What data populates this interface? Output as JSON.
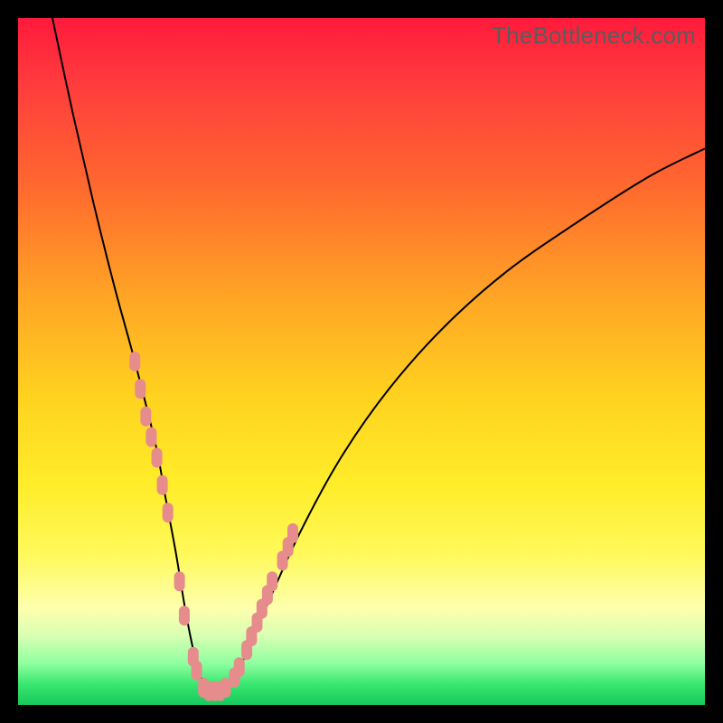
{
  "watermark": "TheBottleneck.com",
  "colors": {
    "frame": "#000000",
    "marker": "#e68c8c",
    "curve": "#000000"
  },
  "chart_data": {
    "type": "line",
    "title": "",
    "xlabel": "",
    "ylabel": "",
    "xlim": [
      0,
      100
    ],
    "ylim": [
      0,
      100
    ],
    "series": [
      {
        "name": "bottleneck-curve",
        "x": [
          5,
          8,
          11,
          14,
          17,
          20,
          21.5,
          23,
          24.5,
          26,
          27.5,
          29,
          32,
          36,
          41,
          47,
          54,
          62,
          71,
          81,
          92,
          100
        ],
        "y": [
          100,
          86,
          73,
          61,
          50,
          38,
          30,
          22,
          13,
          6,
          2,
          2,
          5,
          14,
          25,
          36,
          46,
          55,
          63,
          70,
          77,
          81
        ]
      }
    ],
    "markers": {
      "name": "highlighted-segments",
      "points": [
        {
          "x": 17.0,
          "y": 50
        },
        {
          "x": 17.8,
          "y": 46
        },
        {
          "x": 18.6,
          "y": 42
        },
        {
          "x": 19.4,
          "y": 39
        },
        {
          "x": 20.2,
          "y": 36
        },
        {
          "x": 21.0,
          "y": 32
        },
        {
          "x": 21.8,
          "y": 28
        },
        {
          "x": 23.5,
          "y": 18
        },
        {
          "x": 24.2,
          "y": 13
        },
        {
          "x": 25.5,
          "y": 7
        },
        {
          "x": 26.0,
          "y": 5
        },
        {
          "x": 27.0,
          "y": 2.5
        },
        {
          "x": 27.8,
          "y": 2
        },
        {
          "x": 28.6,
          "y": 2
        },
        {
          "x": 29.4,
          "y": 2
        },
        {
          "x": 30.2,
          "y": 2.5
        },
        {
          "x": 31.5,
          "y": 4
        },
        {
          "x": 32.2,
          "y": 5.5
        },
        {
          "x": 33.3,
          "y": 8
        },
        {
          "x": 34.0,
          "y": 10
        },
        {
          "x": 34.8,
          "y": 12
        },
        {
          "x": 35.5,
          "y": 14
        },
        {
          "x": 36.3,
          "y": 16
        },
        {
          "x": 37.0,
          "y": 18
        },
        {
          "x": 38.5,
          "y": 21
        },
        {
          "x": 39.3,
          "y": 23
        },
        {
          "x": 40.0,
          "y": 25
        }
      ]
    }
  }
}
